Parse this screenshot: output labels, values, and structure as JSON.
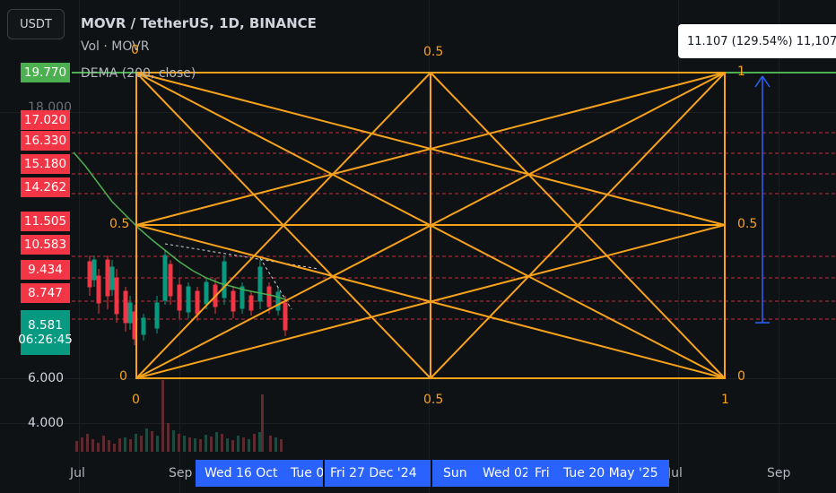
{
  "header": {
    "currency": "USDT",
    "title": "MOVR / TetherUS, 1D, BINANCE",
    "volume_label": "Vol · MOVR",
    "indicator_label": "DEMA (200, close)"
  },
  "price_scale": {
    "current_price": "19.770",
    "red_tags": [
      "17.020",
      "16.330",
      "15.180",
      "14.262",
      "11.505",
      "10.583",
      "9.434",
      "8.747"
    ],
    "last_price": "8.581",
    "countdown": "06:26:45",
    "ticks": [
      "6.000",
      "4.000"
    ],
    "hidden_tick": "18.000"
  },
  "time_axis": {
    "labels": [
      "Jul",
      "Sep",
      "Jul",
      "Sep"
    ],
    "date_tags": [
      "Wed 16 Oct",
      "Tue 0",
      "Fri 27 Dec '24",
      "Sun",
      "Wed 02",
      "Fri",
      "Tue 20 May '25"
    ]
  },
  "measure": {
    "text": "11.107 (129.54%) 11,107"
  },
  "gann_box": {
    "top_left": "0",
    "top_mid": "0.5",
    "top_right": "1",
    "left_mid": "0.5",
    "left_bottom": "0",
    "right_mid": "0.5",
    "right_bottom": "0",
    "bottom_left": "0",
    "bottom_mid": "0.5",
    "bottom_right": "1"
  },
  "colors": {
    "background": "#0f1214",
    "gann": "#f7a21b",
    "current_line": "#4caf50",
    "red_tag": "#f23645",
    "date_tag": "#2962ff",
    "measure_arrow": "#2962ff",
    "dema_line": "#4caf50",
    "level_lines": "#f23645"
  }
}
